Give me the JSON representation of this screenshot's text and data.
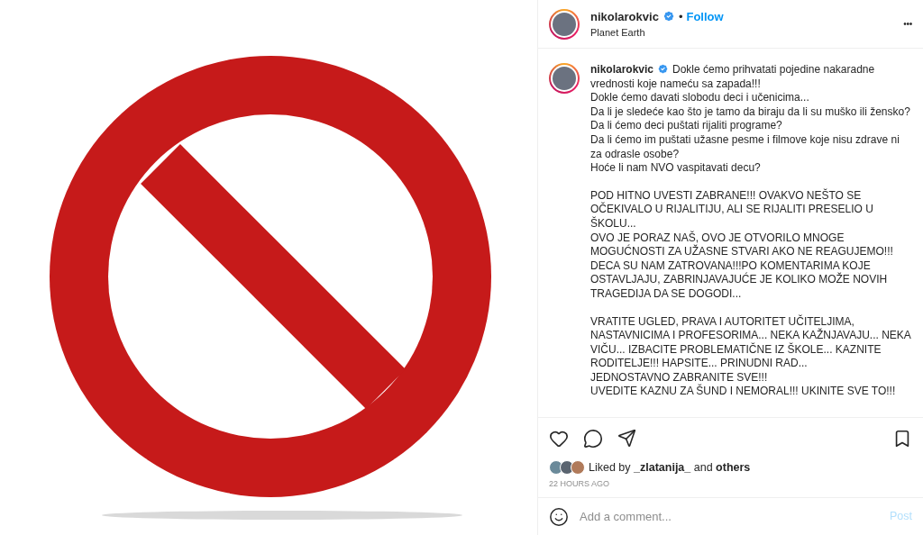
{
  "header": {
    "username": "nikolarokvic",
    "separator": "•",
    "follow": "Follow",
    "location": "Planet Earth",
    "more": "•••"
  },
  "caption": {
    "username": "nikolarokvic",
    "paragraphs": [
      [
        "Dokle ćemo prihvatati pojedine nakaradne vrednosti koje nameću sa zapada!!!",
        "Dokle ćemo davati slobodu deci i učenicima...",
        "Da li je sledeće kao što je tamo da biraju da li su muško ili žensko?",
        "Da li ćemo deci puštati rijaliti programe?",
        "Da li ćemo im puštati užasne pesme i filmove koje nisu zdrave ni za odrasle osobe?",
        "Hoće li nam NVO vaspitavati decu?"
      ],
      [
        "POD HITNO UVESTI ZABRANE!!! OVAKVO NEŠTO SE OČEKIVALO U RIJALITIJU, ALI SE RIJALITI PRESELIO U ŠKOLU...",
        "OVO JE PORAZ NAŠ, OVO JE OTVORILO MNOGE MOGUĆNOSTI ZA UŽASNE STVARI AKO NE REAGUJEMO!!! DECA SU NAM ZATROVANA!!!PO KOMENTARIMA KOJE OSTAVLJAJU, ZABRINJAVAJUĆE JE KOLIKO MOŽE NOVIH TRAGEDIJA DA SE DOGODI..."
      ],
      [
        "VRATITE UGLED, PRAVA I AUTORITET UČITELJIMA, NASTAVNICIMA I PROFESORIMA... NEKA KAŽNJAVAJU... NEKA VIČU... IZBACITE PROBLEMATIČNE IZ ŠKOLE... KAZNITE RODITELJE!!! HAPSITE... PRINUDNI RAD...",
        "JEDNOSTAVNO ZABRANITE SVE!!!",
        "UVEDITE KAZNU ZA ŠUND I NEMORAL!!! UKINITE SVE TO!!!"
      ]
    ]
  },
  "likes": {
    "text": "Liked by **_zlatanija_** and **others**",
    "time": "22 HOURS AGO"
  },
  "comment": {
    "placeholder": "Add a comment...",
    "post": "Post",
    "disabled": true
  }
}
